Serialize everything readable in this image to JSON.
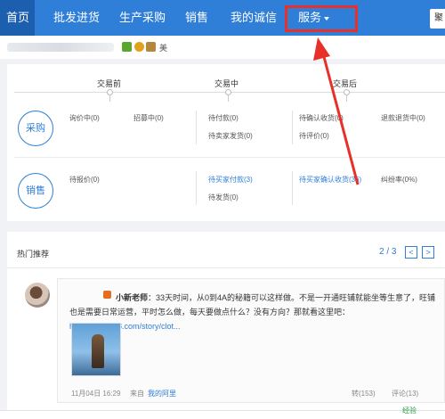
{
  "nav": {
    "items": [
      "首页",
      "批发进货",
      "生产采购",
      "销售",
      "我的诚信",
      "服务"
    ],
    "right_button": "聚"
  },
  "userbar": {
    "extra_text": "美"
  },
  "stages": [
    "交易前",
    "交易中",
    "交易后"
  ],
  "purchase": {
    "button": "采购",
    "before": [
      "询价中(0)",
      "招募中(0)"
    ],
    "during": [
      "待付款(0)",
      "待卖家发货(0)"
    ],
    "after": [
      "待确认收货(0)",
      "待评价(0)"
    ],
    "refund": "退款退货中(0)"
  },
  "sales": {
    "button": "销售",
    "before": [
      "待报价(0)"
    ],
    "during": [
      "待买家付款(3)",
      "待发货(0)"
    ],
    "after": [
      "待买家确认收货(36)"
    ],
    "dispute": "纠纷率(0%)"
  },
  "hot": {
    "title": "热门推荐",
    "pager": "2 / 3",
    "prev": "<",
    "next": ">",
    "post": {
      "author": "小新老师",
      "text": "：33天时间，从0到4A的秘籍可以这样做。不是一开通旺铺就能坐等生意了，旺铺也是需要日常运营，平时怎么做，每天要做点什么？没有方向？那就看这里吧：",
      "link": "http://gys.1688.com/story/clot...",
      "date": "11月04日 16:29",
      "source": "来自",
      "source_name": "我的阿里",
      "forward": "转(153)",
      "comment": "评论(13)"
    }
  },
  "watermark": "经验",
  "colors": {
    "nav": "#2f7ed8",
    "highlight": "#e8302a"
  }
}
